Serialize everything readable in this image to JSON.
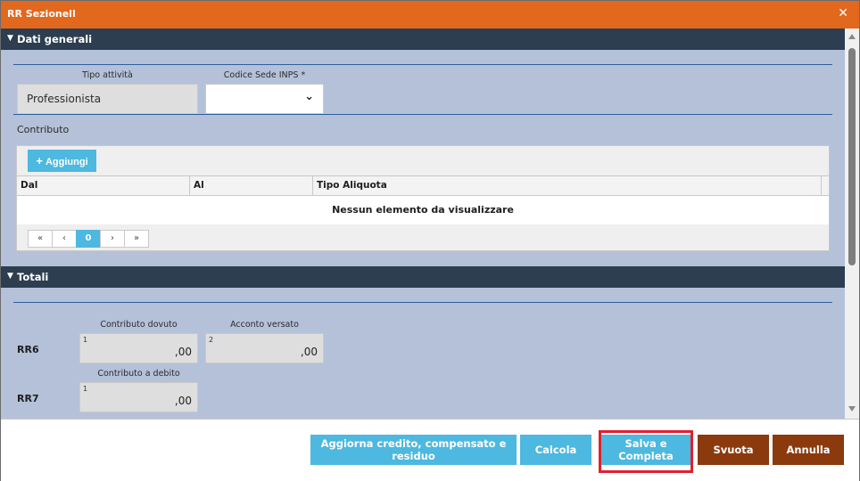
{
  "dialog": {
    "title": "RR Sezionell",
    "close_label": "✕"
  },
  "dati_generali": {
    "header": "Dati generali",
    "tipo_attivita": {
      "label": "Tipo attività",
      "value": "Professionista"
    },
    "codice_sede": {
      "label": "Codice Sede INPS *",
      "value": ""
    },
    "contributo": {
      "label": "Contributo",
      "add_button": "Aggiungi",
      "columns": [
        "Dal",
        "Al",
        "Tipo Aliquota"
      ],
      "empty_message": "Nessun elemento da visualizzare",
      "pager": {
        "first": "«",
        "prev": "‹",
        "current": "0",
        "next": "›",
        "last": "»"
      }
    }
  },
  "totali": {
    "header": "Totali",
    "rr6": {
      "label": "RR6",
      "contributo_dovuto": {
        "label": "Contributo dovuto",
        "index": "1",
        "value": ",00"
      },
      "acconto_versato": {
        "label": "Acconto versato",
        "index": "2",
        "value": ",00"
      }
    },
    "rr7": {
      "label": "RR7",
      "contributo_debito": {
        "label": "Contributo a debito",
        "index": "1",
        "value": ",00"
      }
    }
  },
  "footer": {
    "aggiorna": "Aggiorna credito, compensato e residuo",
    "calcola": "Calcola",
    "salva": "Salva e Completa",
    "svuota": "Svuota",
    "annulla": "Annulla"
  },
  "colors": {
    "title_bar": "#e2681e",
    "section_header": "#2c3e50",
    "body_bg": "#b4c1d9",
    "primary_button": "#4db8e0",
    "dark_button": "#8b3a0e",
    "highlight": "#e0202e"
  }
}
